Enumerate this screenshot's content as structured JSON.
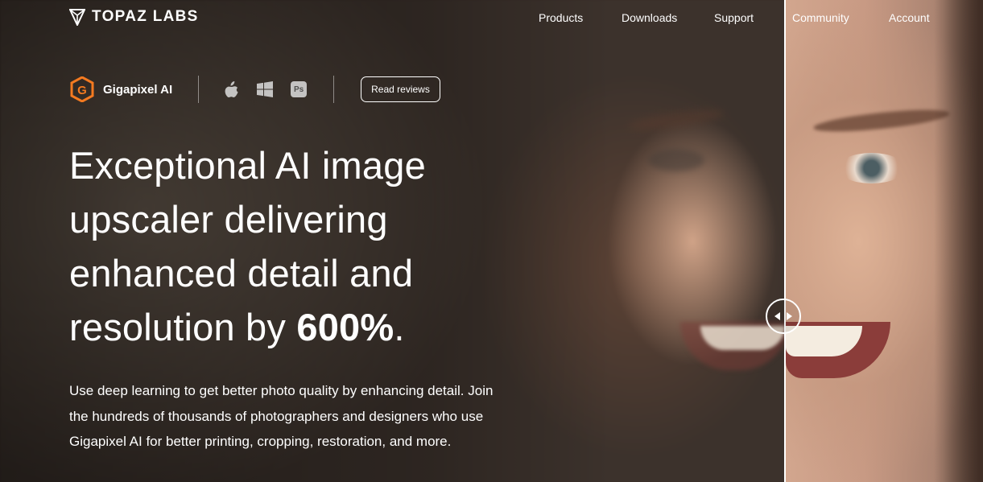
{
  "brand": {
    "name": "TOPAZ LABS",
    "logo_icon": "topaz-diamond-icon"
  },
  "nav": {
    "items": [
      {
        "label": "Products"
      },
      {
        "label": "Downloads"
      },
      {
        "label": "Support"
      },
      {
        "label": "Community"
      },
      {
        "label": "Account"
      }
    ]
  },
  "product": {
    "name": "Gigapixel AI",
    "icon": "gigapixel-g-icon",
    "accent_color": "#f47a20",
    "platforms": [
      "apple-icon",
      "windows-icon",
      "photoshop-icon"
    ],
    "photoshop_label": "Ps",
    "reviews_button": "Read reviews"
  },
  "hero": {
    "headline_line1": "Exceptional AI image",
    "headline_line2": "upscaler delivering",
    "headline_line3": "enhanced detail and",
    "headline_line4_prefix": "resolution by ",
    "headline_highlight": "600%",
    "headline_suffix": ".",
    "subtext": "Use deep learning to get better photo quality by enhancing detail. Join the hundreds of thousands of photographers and designers who use Gigapixel AI for better printing, cropping, restoration, and more."
  },
  "comparison": {
    "handle_icon": "compare-arrows-icon"
  }
}
